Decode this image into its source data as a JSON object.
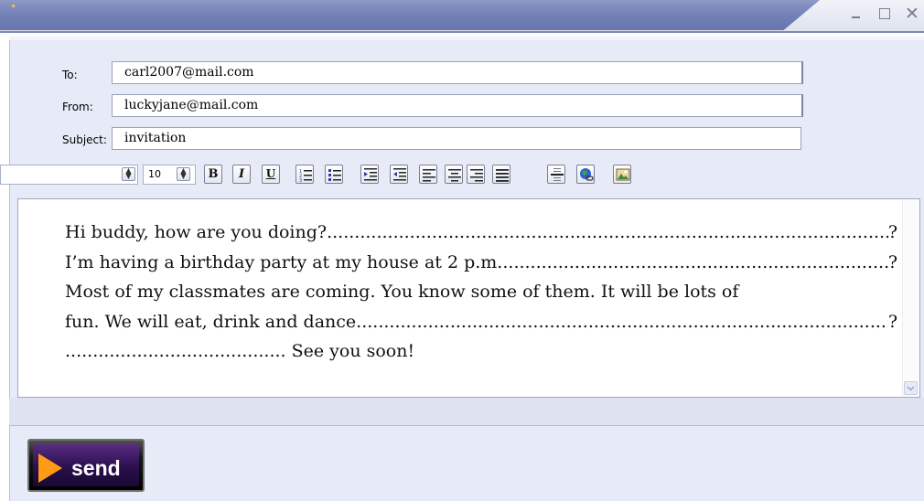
{
  "window": {
    "controls": {
      "minimize": "_",
      "maximize": "□",
      "close": "✕"
    }
  },
  "form": {
    "to_label": "To:",
    "to_value": "carl2007@mail.com",
    "from_label": "From:",
    "from_value": "luckyjane@mail.com",
    "subject_label": "Subject:",
    "subject_value": "invitation"
  },
  "toolbar": {
    "font_size": "10",
    "bold": "B",
    "italic": "I",
    "underline": "U",
    "icons": [
      "numbered-list-icon",
      "bulleted-list-icon",
      "decrease-indent-icon",
      "increase-indent-icon",
      "align-left-icon",
      "align-center-icon",
      "align-right-icon",
      "justify-icon",
      "horizontal-rule-icon",
      "insert-link-icon",
      "insert-image-icon"
    ]
  },
  "body": {
    "line1_text": "Hi buddy, how are you doing? ",
    "line1_end": "?",
    "line2_text": "I’m having a birthday party at my house at 2 p.m. ",
    "line2_end": "?",
    "line3_text": "Most of my classmates are coming. You know some of them. It will be lots of",
    "line4_text": "fun. We will eat, drink and dance. ",
    "line4_end": "?",
    "line5_blank": "....................................... ",
    "line5_text": ". See you soon!"
  },
  "send": {
    "label": "send"
  },
  "colors": {
    "title_tab": "#7382b8",
    "panel": "#e7ebf8",
    "send_bg": "#2a0f4d",
    "send_arrow": "#ff9a14"
  }
}
